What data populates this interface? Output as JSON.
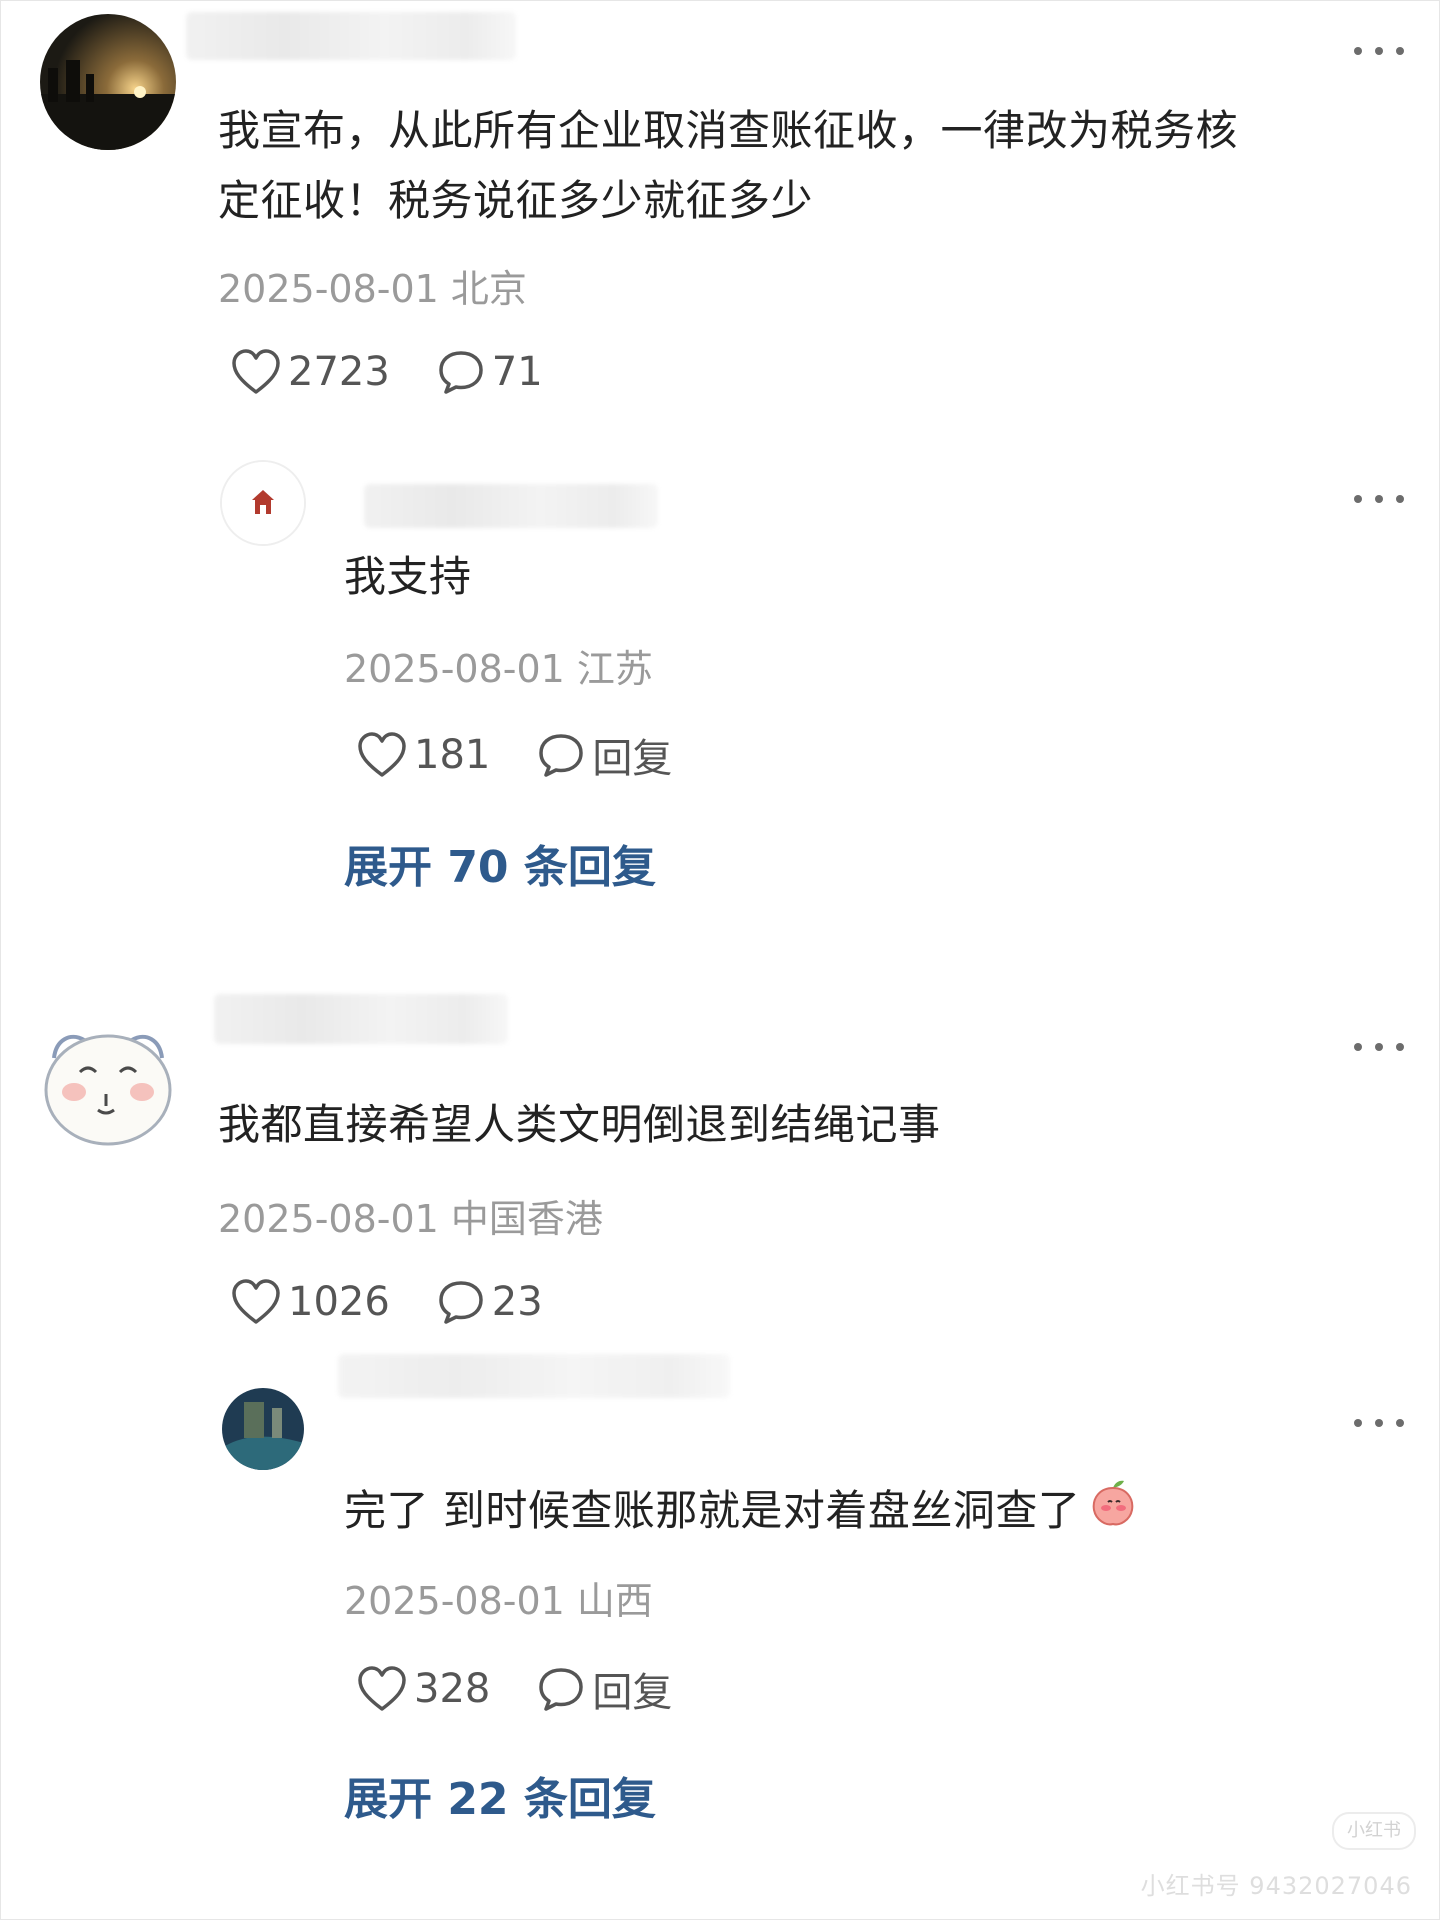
{
  "comments": [
    {
      "content_line1": "我宣布，从此所有企业取消查账征收，一律改为税务核",
      "content_line2": "定征收！税务说征多少就征多少",
      "date": "2025-08-01",
      "location": "北京",
      "likes": "2723",
      "replies": "71",
      "reply": {
        "content": "我支持",
        "date": "2025-08-01",
        "location": "江苏",
        "likes": "181",
        "reply_label": "回复"
      },
      "expand_label": "展开 70 条回复"
    },
    {
      "content_line1": "我都直接希望人类文明倒退到结绳记事",
      "date": "2025-08-01",
      "location": "中国香港",
      "likes": "1026",
      "replies": "23",
      "reply": {
        "content": "完了 到时候查账那就是对着盘丝洞查了",
        "date": "2025-08-01",
        "location": "山西",
        "likes": "328",
        "reply_label": "回复"
      },
      "expand_label": "展开 22 条回复"
    }
  ],
  "watermark": {
    "badge": "小红书",
    "text": "小红书号 9432027046"
  },
  "colors": {
    "link_blue": "#2e5a8c",
    "meta_gray": "#9a9a9a"
  }
}
